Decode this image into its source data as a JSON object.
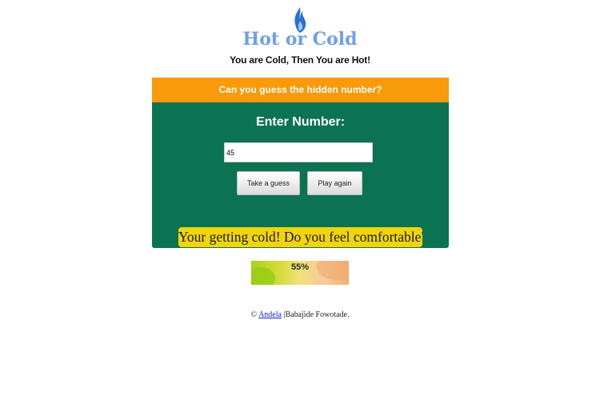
{
  "header": {
    "logo_icon": "flame-icon",
    "title": "Hot or Cold",
    "tagline": "You are Cold, Then You are Hot!"
  },
  "panel": {
    "header_text": "Can you guess the hidden number?",
    "enter_label": "Enter Number:",
    "input_value": "45",
    "guess_button": "Take a guess",
    "again_button": "Play again",
    "feedback": "Your getting cold! Do you feel comfortable?"
  },
  "meter": {
    "label": "55%",
    "value": 0.55
  },
  "footer": {
    "copyright": "©",
    "link_text": "Andela",
    "separator": "|",
    "author": "Babajide Fowotade."
  },
  "colors": {
    "title": "#6f9df0",
    "panel_header": "#f89a0a",
    "panel_body": "#0b7352",
    "feedback_bg": "#f1d40a",
    "flame_outer": "#2b6fd6",
    "flame_inner": "#9bc7f5"
  }
}
